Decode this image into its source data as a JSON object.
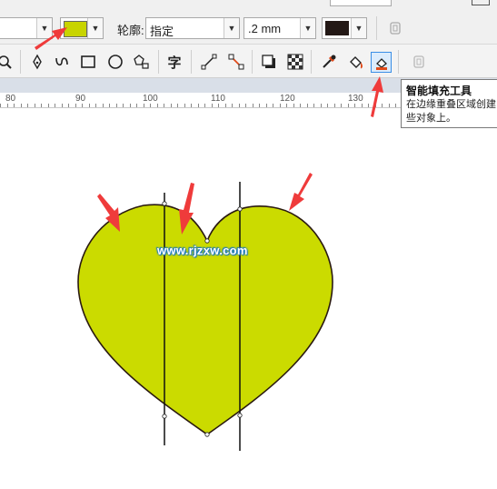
{
  "property_bar": {
    "fill_color": "#c8d400",
    "outline_label": "轮廓:",
    "outline_style_value": "指定",
    "outline_width_value": ".2 mm",
    "outline_color": "#231815",
    "dropdown_glyph": "▼"
  },
  "toolbar": {
    "tools": [
      {
        "name": "zoom-tool-icon"
      },
      {
        "name": "pen-tool-icon"
      },
      {
        "name": "freehand-tool-icon"
      },
      {
        "name": "rectangle-tool-icon"
      },
      {
        "name": "ellipse-tool-icon"
      },
      {
        "name": "polygon-tool-icon"
      },
      {
        "name": "text-tool-icon",
        "glyph": "字"
      },
      {
        "name": "connector-tool-icon"
      },
      {
        "name": "dimension-tool-icon"
      },
      {
        "name": "shadow-tool-icon"
      },
      {
        "name": "transparency-tool-icon"
      },
      {
        "name": "eyedropper-tool-icon"
      },
      {
        "name": "interactive-fill-tool-icon"
      },
      {
        "name": "smart-fill-tool-icon"
      },
      {
        "name": "disabled-tool-icon"
      }
    ]
  },
  "ruler": {
    "ticks": [
      "80",
      "90",
      "100",
      "110",
      "120",
      "130"
    ]
  },
  "tooltip": {
    "title": "智能填充工具",
    "line1": "在边缘重叠区域创建",
    "line2": "些对象上。"
  },
  "canvas": {
    "heart_fill": "#cbdb00",
    "heart_stroke": "#2a1a10",
    "watermark": "www.rjzxw.com",
    "arrow_color": "#ef3b3b"
  }
}
